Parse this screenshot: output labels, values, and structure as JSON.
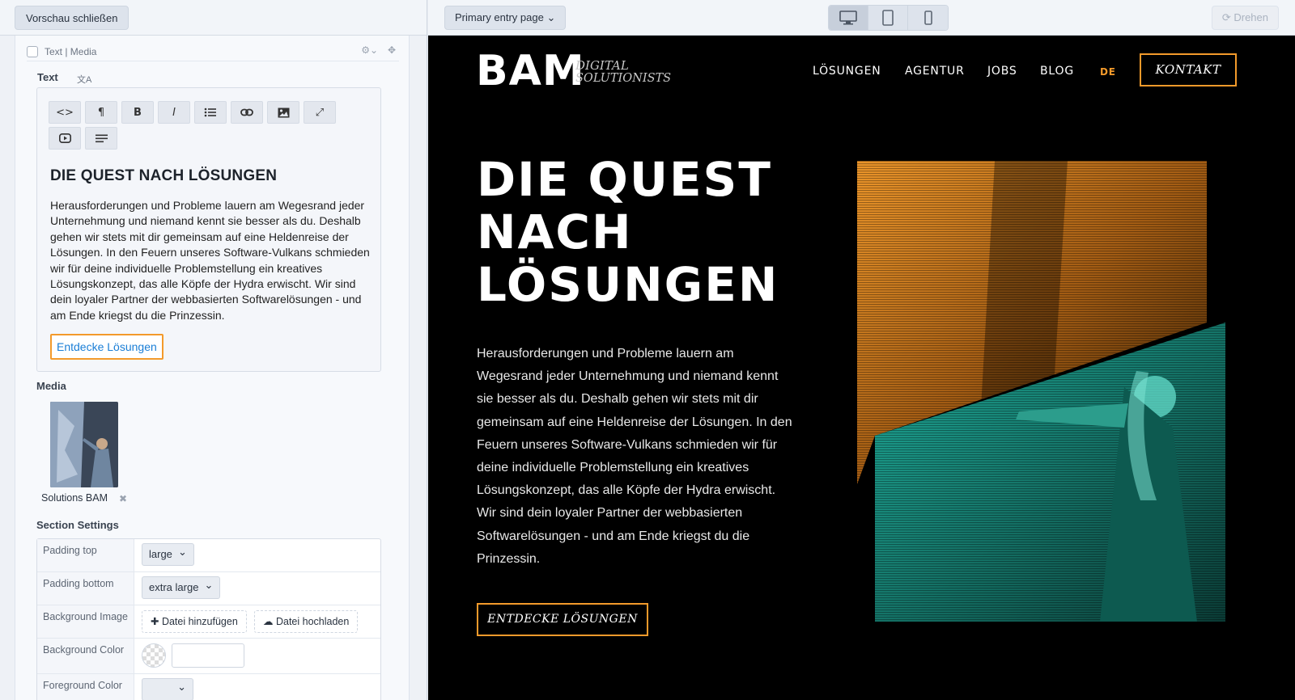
{
  "left_panel": {
    "close_preview": "Vorschau schließen",
    "element_title": "Text | Media",
    "text_label": "Text",
    "editor": {
      "title": "DIE QUEST NACH LÖSUNGEN",
      "body": "Herausforderungen und Probleme lauern am Wegesrand jeder Unternehmung und niemand kennt sie besser als du. Deshalb gehen wir stets mit dir gemeinsam auf eine Heldenreise der Lösungen. In den Feuern unseres Software-Vulkans schmieden wir für deine individuelle Problemstellung ein kreatives Lösungskonzept, das alle Köpfe der Hydra erwischt. Wir sind dein loyaler Partner der webbasierten Softwarelösungen - und am Ende kriegst du die Prinzessin.",
      "link": "Entdecke Lösungen"
    },
    "toolbar_icons": [
      "code-icon",
      "paragraph-icon",
      "bold-icon",
      "italic-icon",
      "list-icon",
      "link-icon",
      "image-icon",
      "fullscreen-icon",
      "video-icon",
      "align-icon"
    ],
    "media_label": "Media",
    "media_name": "Solutions BAM",
    "section_settings_label": "Section Settings",
    "settings": {
      "padding_top_label": "Padding top",
      "padding_top_value": "large",
      "padding_bottom_label": "Padding bottom",
      "padding_bottom_value": "extra large",
      "bg_image_label": "Background Image",
      "add_file": "Datei hinzufügen",
      "upload_file": "Datei hochladen",
      "bg_color_label": "Background Color",
      "fg_color_label": "Foreground Color"
    }
  },
  "preview_toolbar": {
    "entry_select": "Primary entry page",
    "rotate": "Drehen",
    "devices": [
      "desktop-icon",
      "tablet-icon",
      "phone-icon"
    ]
  },
  "site": {
    "logo_text": "BAM",
    "logo_line1": "DIGITAL",
    "logo_line2": "SOLUTIONISTS",
    "nav": [
      "LÖSUNGEN",
      "AGENTUR",
      "JOBS",
      "BLOG"
    ],
    "lang": "DE",
    "contact": "KONTAKT",
    "hero_title": "DIE QUEST NACH LÖSUNGEN",
    "hero_body": "Herausforderungen und Probleme lauern am Wegesrand jeder Unternehmung und niemand kennt sie besser als du. Deshalb gehen wir stets mit dir gemeinsam auf eine Heldenreise der Lösungen. In den Feuern unseres Software-Vulkans schmieden wir für deine individuelle Problemstellung ein kreatives Lösungskonzept, das alle Köpfe der Hydra erwischt. Wir sind dein loyaler Partner der webbasierten Softwarelösungen - und am Ende kriegst du die Prinzessin.",
    "hero_cta": "ENTDECKE LÖSUNGEN"
  },
  "colors": {
    "accent": "#f39a2b",
    "teal": "#1a9c8c",
    "link": "#1a7ed6",
    "site_bg": "#000000"
  }
}
